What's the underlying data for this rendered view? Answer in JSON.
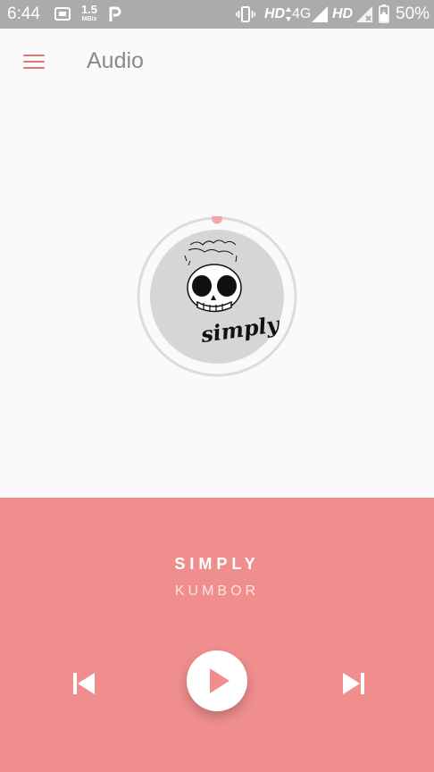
{
  "status_bar": {
    "time": "6:44",
    "network_speed_value": "1.5",
    "network_speed_unit": "MB/s",
    "hd1": "HD",
    "network_type": "4G",
    "hd2": "HD",
    "battery_percent": "50%",
    "icons": [
      "screen-icon",
      "parking-icon",
      "vibrate-icon",
      "signal-icon",
      "battery-icon"
    ]
  },
  "app_bar": {
    "title": "Audio",
    "menu_icon": "hamburger-menu-icon"
  },
  "now_playing": {
    "title": "SIMPLY",
    "artist": "KUMBOR",
    "progress_fraction": 0.0,
    "art_text": "simply"
  },
  "controls": {
    "prev_icon": "skip-previous-icon",
    "play_icon": "play-icon",
    "next_icon": "skip-next-icon"
  },
  "colors": {
    "accent": "#f08e8e",
    "menu": "#e57373",
    "status_bar": "#ababab"
  }
}
